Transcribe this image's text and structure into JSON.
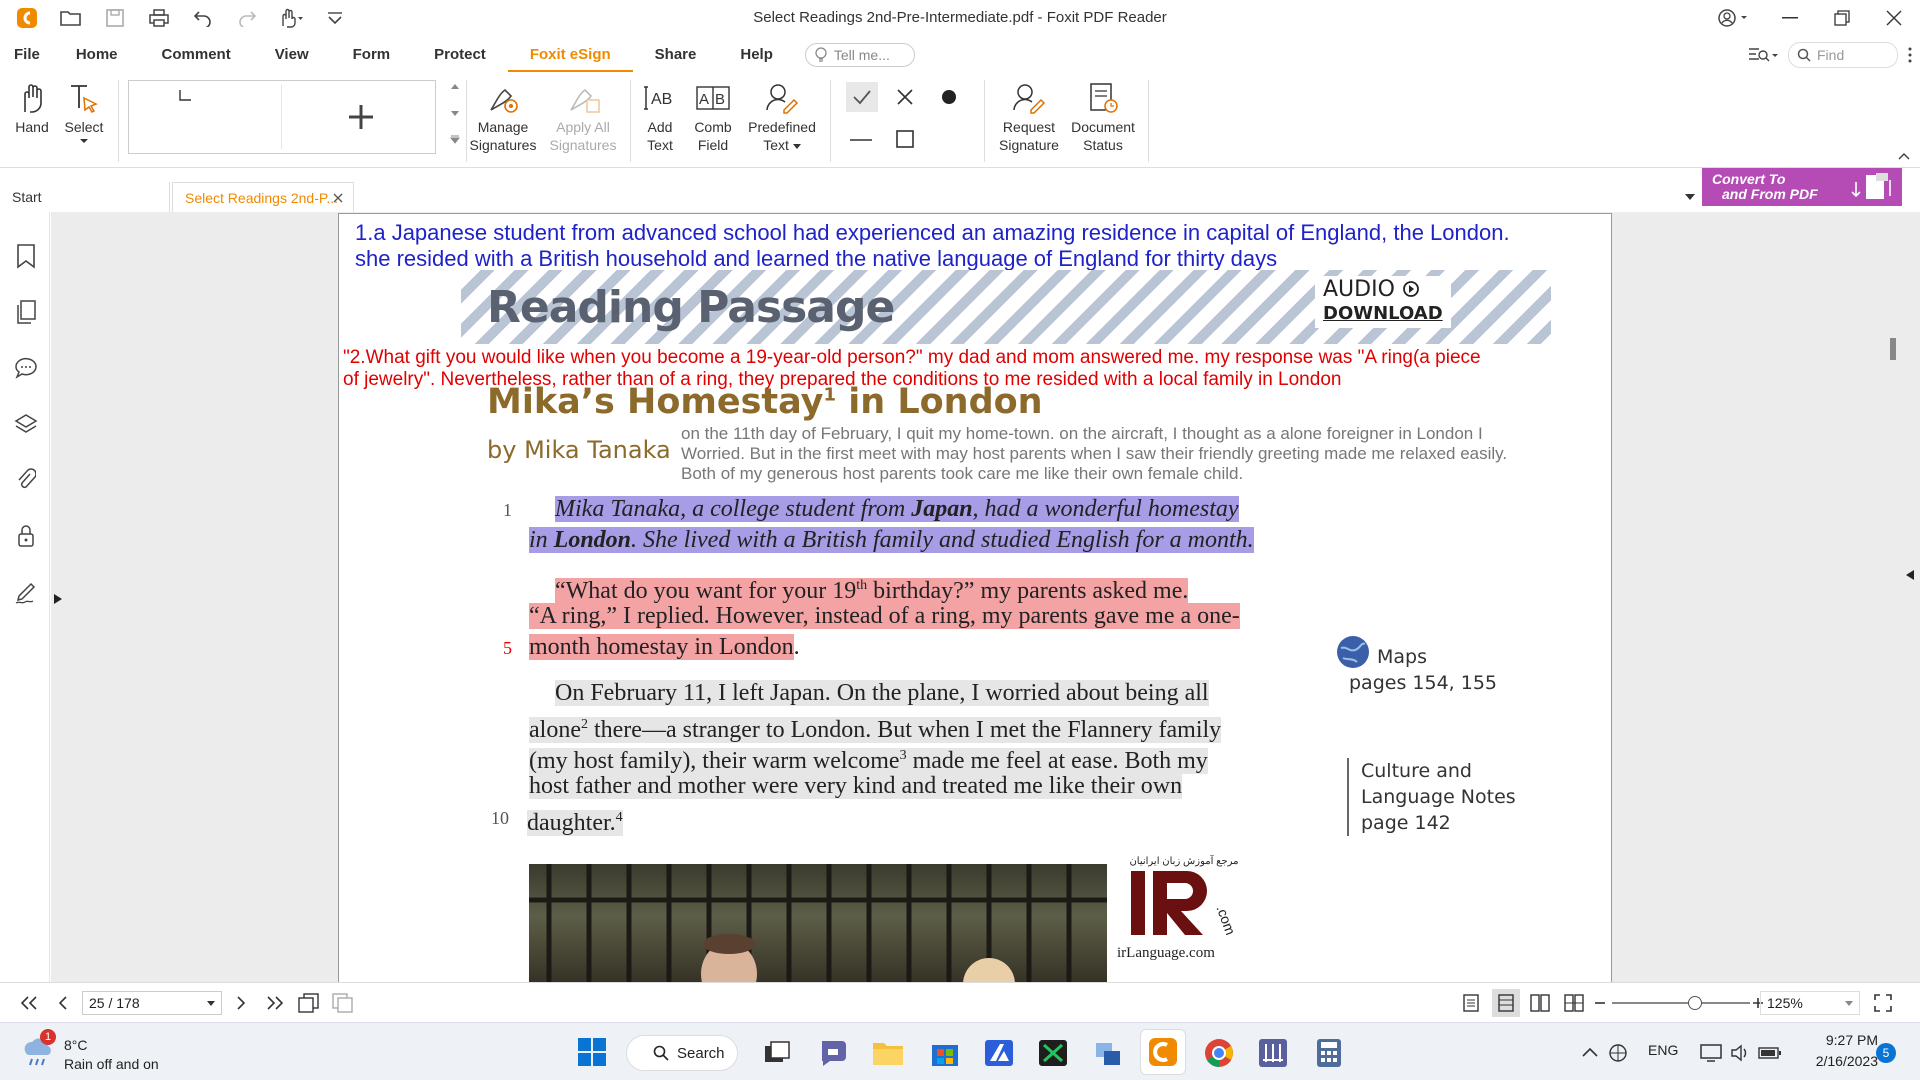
{
  "window": {
    "title": "Select Readings 2nd-Pre-Intermediate.pdf - Foxit PDF Reader"
  },
  "menu": {
    "items": [
      "File",
      "Home",
      "Comment",
      "View",
      "Form",
      "Protect",
      "Foxit eSign",
      "Share",
      "Help"
    ],
    "active": "Foxit eSign",
    "tell_me": "Tell me...",
    "find": "Find"
  },
  "ribbon": {
    "hand": "Hand",
    "select": "Select",
    "manage_signatures": [
      "Manage",
      "Signatures"
    ],
    "apply_all_signatures": [
      "Apply All",
      "Signatures"
    ],
    "add_text": [
      "Add",
      "Text"
    ],
    "comb_field": [
      "Comb",
      "Field"
    ],
    "predefined_text": [
      "Predefined",
      "Text"
    ],
    "request_signature": [
      "Request",
      "Signature"
    ],
    "document_status": [
      "Document",
      "Status"
    ]
  },
  "tabs": {
    "start": "Start",
    "document": "Select Readings 2nd-P..."
  },
  "convert_banner": [
    "Convert To",
    "and From PDF"
  ],
  "page": {
    "annotation_blue": [
      "1.a Japanese student from advanced school had experienced an amazing residence  in capital of England, the London.",
      "she resided with a British household and learned the native language of England for thirty days"
    ],
    "banner_heading": "Reading Passage",
    "audio": "AUDIO",
    "download": "DOWNLOAD",
    "annotation_red": [
      "\"2.What gift you would like when you become a 19-year-old person?\" my dad and mom answered me. my response was \"A ring(a piece",
      "of jewelry\". Nevertheless, rather than of a ring, they prepared the conditions to me resided with a local family in London"
    ],
    "story_title": "Mika’s Homestay",
    "story_title_sup": "1",
    "story_title_end": " in London",
    "byline": "by Mika Tanaka",
    "annotation_gray": [
      "on the 11th day of February, I quit my home-town. on the aircraft, I thought as a alone foreigner in London I",
      "Worried. But in the first meet with may host parents when I saw their friendly greeting made me relaxed easily.",
      "Both of my generous host parents took care me like their own female child."
    ],
    "line_numbers": [
      "1",
      "5",
      "10"
    ],
    "para1": [
      "Mika Tanaka, a college student from ",
      "Japan",
      ", had a wonderful homestay",
      "in ",
      "London",
      ". She lived with a British family and studied English for a month."
    ],
    "para2": [
      "“What do you want for your 19",
      "th",
      " birthday?” my parents asked me.",
      "“A ring,” I replied. However, instead of a ring, my parents gave me a one-",
      "month homestay in London"
    ],
    "para3": [
      "On February 11, I left Japan. On the plane, I worried about being all",
      "alone",
      "2",
      " there—a stranger to London. But when I met the Flannery family",
      "(my host family), their warm welcome",
      "3",
      " made me feel at ease. Both my",
      "host father and mother were very kind and treated me like their own",
      "daughter.",
      "4"
    ],
    "maps": [
      "Maps",
      "pages 154, 155"
    ],
    "culture": [
      "Culture and",
      "Language Notes",
      "page 142"
    ],
    "logo_text": "irLanguage.com",
    "logo_persian": "مرجع آموزش زبان ایرانیان",
    "logo_com": ".com"
  },
  "statusbar": {
    "page_indicator": "25 / 178",
    "zoom": "125%"
  },
  "taskbar": {
    "weather_temp": "8°C",
    "weather_desc": "Rain off and on",
    "weather_badge": "1",
    "search": "Search",
    "lang": "ENG",
    "time": "9:27 PM",
    "date": "2/16/2023",
    "notif_count": "5"
  },
  "colors": {
    "accent": "#f08a00",
    "annotation_blue": "#1f22c8",
    "annotation_red": "#e00000",
    "highlight_purple": "#a79ce6",
    "highlight_pink": "#f4a3a5",
    "convert_banner": "#b54bb4"
  }
}
